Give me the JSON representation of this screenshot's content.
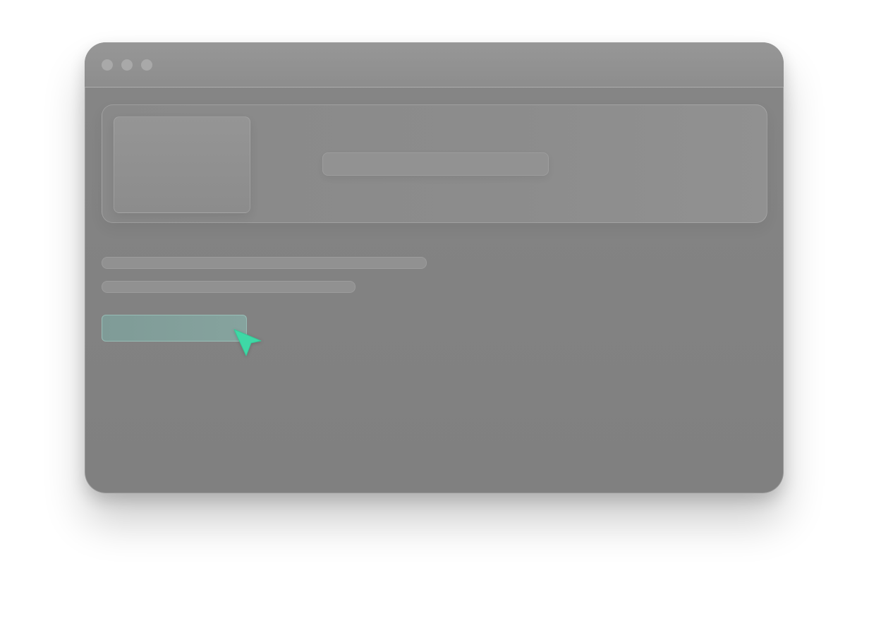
{
  "window": {
    "title": ""
  },
  "hero": {
    "heading": ""
  },
  "content": {
    "lines": [
      "",
      ""
    ]
  },
  "primary_button": {
    "label": ""
  },
  "colors": {
    "accent": "#3fd8a6",
    "window_bg": "#838383",
    "titlebar_bg": "#949494",
    "button_bg": "#84a19c"
  },
  "icons": {
    "cursor": "pointer-arrow-icon"
  }
}
